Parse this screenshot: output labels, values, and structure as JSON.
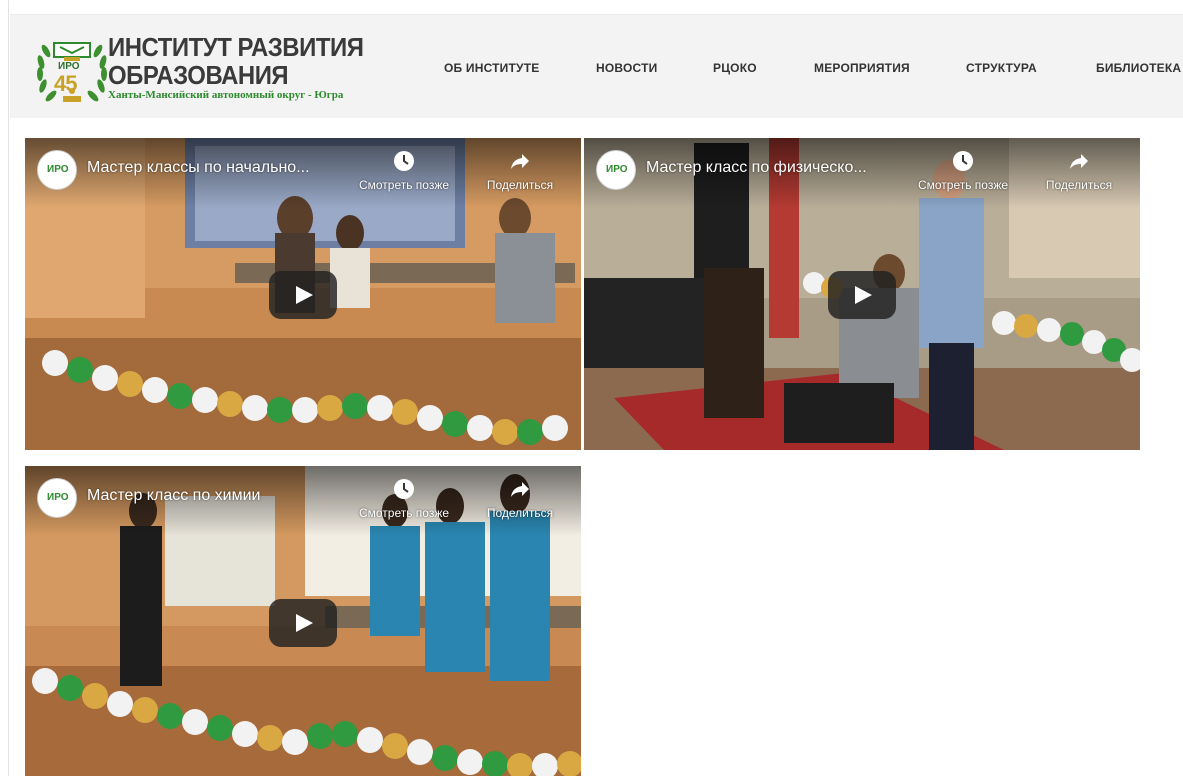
{
  "header": {
    "logo": {
      "title_line1": "ИНСТИТУТ РАЗВИТИЯ",
      "title_line2": "ОБРАЗОВАНИЯ",
      "subtitle": "Ханты-Мансийский автономный округ - Югра",
      "badge_text": "ИРО",
      "anniversary": "45"
    },
    "nav": [
      {
        "label": "ОБ ИНСТИТУТЕ"
      },
      {
        "label": "НОВОСТИ"
      },
      {
        "label": "РЦОКО"
      },
      {
        "label": "МЕРОПРИЯТИЯ"
      },
      {
        "label": "СТРУКТУРА"
      },
      {
        "label": "БИБЛИОТЕКА"
      }
    ]
  },
  "colors": {
    "header_bg": "#f3f3f3",
    "nav_text": "#333333",
    "logo_green": "#2e8a2e",
    "logo_gold": "#c9a227",
    "play_button": "#212121"
  },
  "videos": [
    {
      "title": "Мастер классы по начально...",
      "watch_later": "Смотреть позже",
      "share": "Поделиться",
      "channel_badge": "ИРО"
    },
    {
      "title": "Мастер класс по физическо...",
      "watch_later": "Смотреть позже",
      "share": "Поделиться",
      "channel_badge": "ИРО"
    },
    {
      "title": "Мастер класс по химии",
      "watch_later": "Смотреть позже",
      "share": "Поделиться",
      "channel_badge": "ИРО"
    }
  ],
  "icons": {
    "watch_later": "clock-icon",
    "share": "share-arrow-icon",
    "play": "play-icon"
  }
}
